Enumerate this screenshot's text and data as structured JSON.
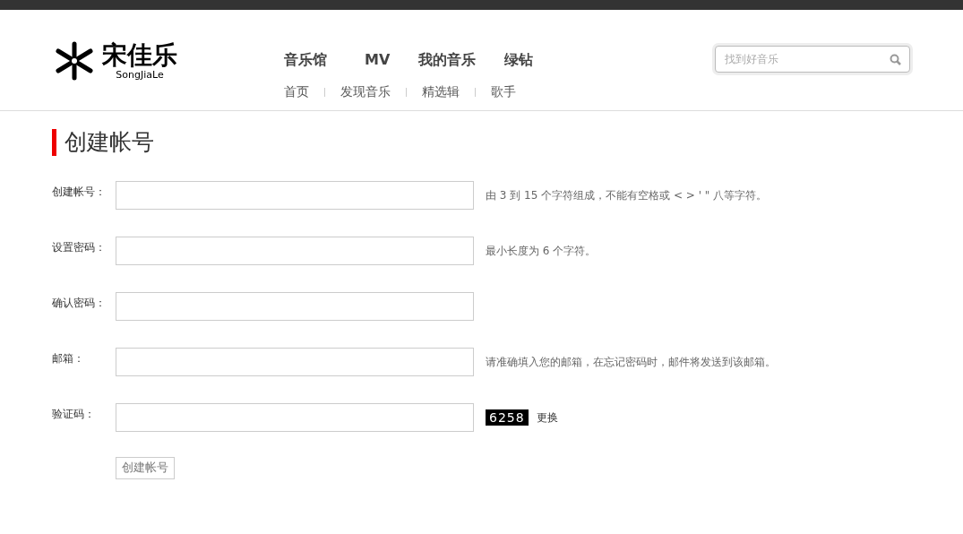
{
  "logo": {
    "title": "宋佳乐",
    "subtitle": "SongJiaLe"
  },
  "main_nav": [
    {
      "label": "音乐馆"
    },
    {
      "label": "MV"
    },
    {
      "label": "我的音乐"
    },
    {
      "label": "绿钻"
    }
  ],
  "sub_nav": [
    {
      "label": "首页"
    },
    {
      "label": "发现音乐"
    },
    {
      "label": "精选辑"
    },
    {
      "label": "歌手"
    }
  ],
  "search": {
    "placeholder": "找到好音乐"
  },
  "page_title": "创建帐号",
  "form": [
    {
      "kind": "text",
      "label": "创建帐号：",
      "hint": "由 3 到 15 个字符组成，不能有空格或 < > ' \" 八等字符。"
    },
    {
      "kind": "text",
      "label": "设置密码：",
      "hint": "最小长度为 6 个字符。"
    },
    {
      "kind": "text",
      "label": "确认密码："
    },
    {
      "kind": "text",
      "label": "邮箱：",
      "hint": "请准确填入您的邮箱，在忘记密码时，邮件将发送到该邮箱。"
    },
    {
      "kind": "captcha",
      "label": "验证码：",
      "captcha": "6258",
      "refresh": "更换"
    }
  ],
  "submit": "创建帐号"
}
